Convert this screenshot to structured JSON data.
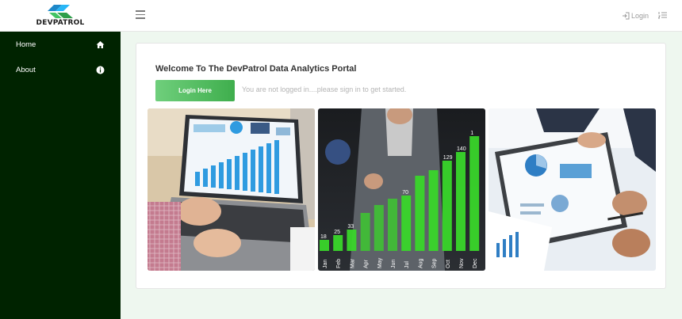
{
  "brand": {
    "name": "DEVPATROL",
    "logo_icon": "devpatrol-logo-icon"
  },
  "header": {
    "menu_icon": "hamburger-icon",
    "login_label": "Login",
    "login_icon": "sign-in-icon",
    "list_icon": "list-ordered-icon"
  },
  "sidebar": {
    "items": [
      {
        "label": "Home",
        "icon": "home-icon"
      },
      {
        "label": "About",
        "icon": "info-icon"
      }
    ]
  },
  "main": {
    "welcome_title": "Welcome To The DevPatrol Data Analytics Portal",
    "login_button": "Login Here",
    "notice": "You are not logged in....please sign in to get started.",
    "images": [
      {
        "subject": "laptop-analytics-dashboard"
      },
      {
        "subject": "businesswoman-monthly-bar-chart"
      },
      {
        "subject": "documents-with-charts-meeting"
      }
    ],
    "month_chart": {
      "months": [
        "Jan",
        "Feb",
        "Mar",
        "Apr",
        "May",
        "Jun",
        "Jul",
        "Aug",
        "Sep",
        "Oct",
        "Nov",
        "Dec"
      ],
      "labels": [
        "18",
        "25",
        "33",
        "",
        "",
        "",
        "70",
        "",
        "",
        "129",
        "140",
        "1"
      ]
    }
  },
  "colors": {
    "sidebar_bg": "#002300",
    "page_bg": "#eef7ef",
    "accent_green": "#3fae4d",
    "bar_green": "#39d62a"
  }
}
